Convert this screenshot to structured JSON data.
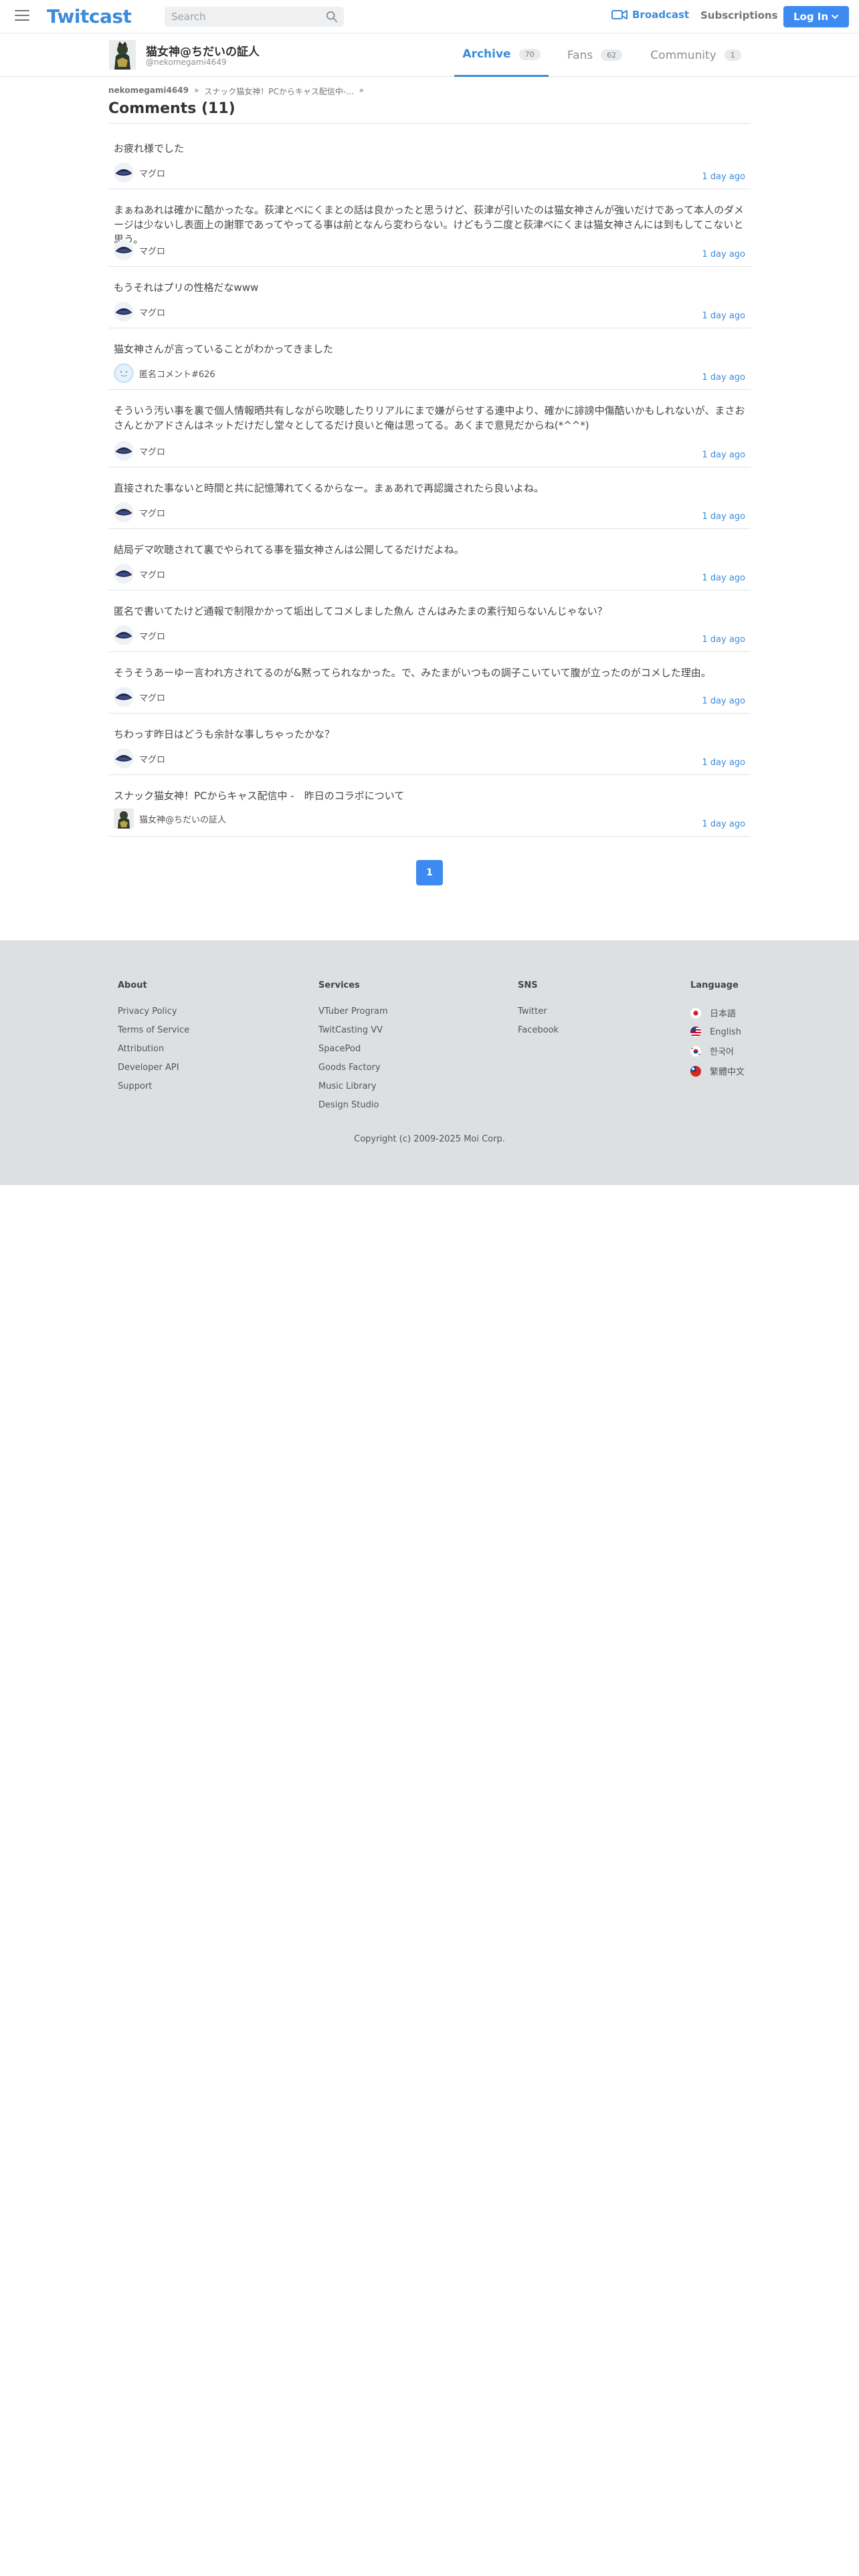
{
  "header": {
    "logo": "Twitcast",
    "search_placeholder": "Search",
    "broadcast_label": "Broadcast",
    "subscriptions_label": "Subscriptions",
    "login_label": "Log In",
    "accent_color": "#3d8bd8"
  },
  "profile": {
    "name": "猫女神@ちだいの証人",
    "handle": "@nekomegami4649",
    "tabs": [
      {
        "label": "Archive",
        "count": "70",
        "active": true
      },
      {
        "label": "Fans",
        "count": "62",
        "active": false
      },
      {
        "label": "Community",
        "count": "1",
        "active": false
      }
    ]
  },
  "breadcrumb": {
    "user": "nekomegami4649",
    "sep1": "»",
    "movie": "スナック猫女神！PCからキャス配信中-...",
    "sep2": "»"
  },
  "page_title": "Comments (11)",
  "comments": [
    {
      "text": "お疲れ様でした",
      "author": "マグロ",
      "time": "1 day ago",
      "avatar": "eye-avatar"
    },
    {
      "text": "まぁねあれは確かに酷かったな。荻津とべにくまとの話は良かったと思うけど、荻津が引いたのは猫女神さんが強いだけであって本人のダメージは少ないし表面上の謝罪であってやってる事は前となんら変わらない。けどもう二度と荻津べにくまは猫女神さんには到もしてこないと思う。",
      "author": "マグロ",
      "time": "1 day ago",
      "avatar": "eye-avatar"
    },
    {
      "text": "もうそれはプリの性格だなwww",
      "author": "マグロ",
      "time": "1 day ago",
      "avatar": "eye-avatar"
    },
    {
      "text": "猫女神さんが言っていることがわかってきました",
      "author": "匿名コメント#626",
      "time": "1 day ago",
      "avatar": "anon-avatar"
    },
    {
      "text": "そういう汚い事を裏で個人情報晒共有しながら吹聴したりリアルにまで嫌がらせする連中より、確かに誹謗中傷酷いかもしれないが、まさおさんとかアドさんはネットだけだし堂々としてるだけ良いと俺は思ってる。あくまで意見だからね(*^^*)",
      "author": "マグロ",
      "time": "1 day ago",
      "avatar": "eye-avatar"
    },
    {
      "text": "直接された事ないと時間と共に記憶薄れてくるからなー。まぁあれで再認識されたら良いよね。",
      "author": "マグロ",
      "time": "1 day ago",
      "avatar": "eye-avatar"
    },
    {
      "text": "結局デマ吹聴されて裏でやられてる事を猫女神さんは公開してるだけだよね。",
      "author": "マグロ",
      "time": "1 day ago",
      "avatar": "eye-avatar"
    },
    {
      "text": "匿名で書いてたけど通報で制限かかって垢出してコメしました魚ん さんはみたまの素行知らないんじゃない？",
      "author": "マグロ",
      "time": "1 day ago",
      "avatar": "eye-avatar"
    },
    {
      "text": "そうそうあーゆー言われ方されてるのが&黙ってられなかった。で、みたまがいつもの調子こいていて腹が立ったのがコメした理由。",
      "author": "マグロ",
      "time": "1 day ago",
      "avatar": "eye-avatar"
    },
    {
      "text": "ちわっす昨日はどうも余計な事しちゃったかな？",
      "author": "マグロ",
      "time": "1 day ago",
      "avatar": "eye-avatar"
    },
    {
      "text": "スナック猫女神！PCからキャス配信中 -　昨日のコラボについて",
      "author": "猫女神@ちだいの証人",
      "time": "1 day ago",
      "avatar": "owner-avatar"
    }
  ],
  "pager": {
    "current": "1"
  },
  "footer": {
    "about": {
      "title": "About",
      "links": [
        "Privacy Policy",
        "Terms of Service",
        "Attribution",
        "Developer API",
        "Support"
      ]
    },
    "services": {
      "title": "Services",
      "links": [
        "VTuber Program",
        "TwitCasting VV",
        "SpacePod",
        "Goods Factory",
        "Music Library",
        "Design Studio"
      ]
    },
    "sns": {
      "title": "SNS",
      "links": [
        "Twitter",
        "Facebook"
      ]
    },
    "language": {
      "title": "Language",
      "items": [
        "日本語",
        "English",
        "한국어",
        "繁體中文"
      ]
    },
    "copyright": "Copyright (c) 2009-2025 Moi Corp."
  }
}
